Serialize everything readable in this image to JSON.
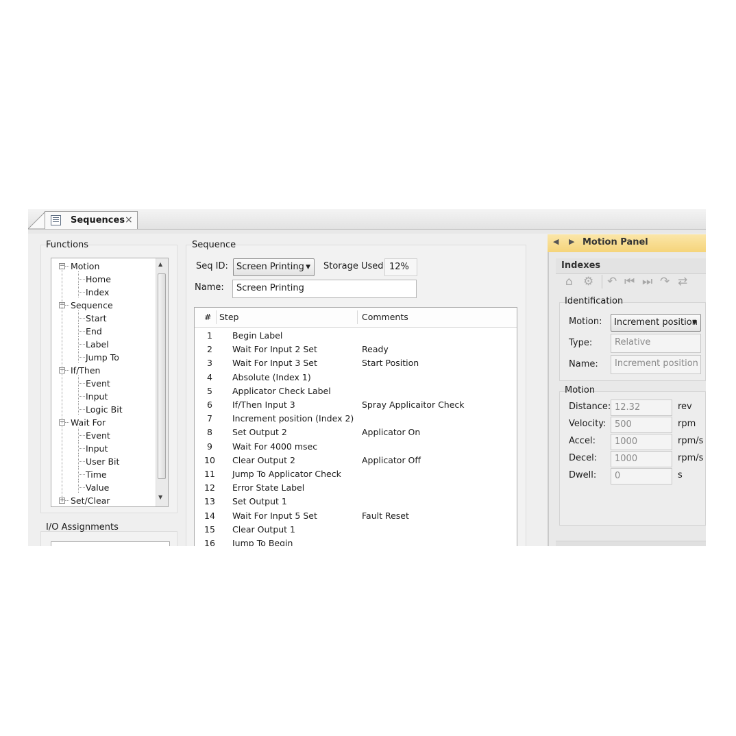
{
  "tab": {
    "title": "Sequences",
    "close": "×"
  },
  "functions": {
    "title": "Functions",
    "tree": [
      {
        "label": "Motion",
        "level": 0,
        "expander": "−"
      },
      {
        "label": "Home",
        "level": 1
      },
      {
        "label": "Index",
        "level": 1
      },
      {
        "label": "Sequence",
        "level": 0,
        "expander": "−"
      },
      {
        "label": "Start",
        "level": 1
      },
      {
        "label": "End",
        "level": 1
      },
      {
        "label": "Label",
        "level": 1
      },
      {
        "label": "Jump To",
        "level": 1
      },
      {
        "label": "If/Then",
        "level": 0,
        "expander": "−"
      },
      {
        "label": "Event",
        "level": 1
      },
      {
        "label": "Input",
        "level": 1
      },
      {
        "label": "Logic Bit",
        "level": 1
      },
      {
        "label": "Wait For",
        "level": 0,
        "expander": "−"
      },
      {
        "label": "Event",
        "level": 1
      },
      {
        "label": "Input",
        "level": 1
      },
      {
        "label": "User Bit",
        "level": 1
      },
      {
        "label": "Time",
        "level": 1
      },
      {
        "label": "Value",
        "level": 1
      },
      {
        "label": "Set/Clear",
        "level": 0,
        "expander": "+"
      }
    ]
  },
  "io": {
    "title": "I/O Assignments"
  },
  "sequence": {
    "title": "Sequence",
    "seq_id_label": "Seq ID:",
    "seq_id_value": "Screen Printing",
    "storage_label": "Storage Used:",
    "storage_value": "12%",
    "name_label": "Name:",
    "name_value": "Screen Printing",
    "columns": [
      "#",
      "Step",
      "Comments"
    ],
    "rows": [
      {
        "n": "1",
        "step": "Begin Label",
        "comment": ""
      },
      {
        "n": "2",
        "step": "Wait For Input 2 Set",
        "comment": "Ready"
      },
      {
        "n": "3",
        "step": "Wait For Input 3 Set",
        "comment": "Start Position"
      },
      {
        "n": "4",
        "step": "Absolute (Index 1)",
        "comment": ""
      },
      {
        "n": "5",
        "step": "Applicator Check Label",
        "comment": ""
      },
      {
        "n": "6",
        "step": "If/Then Input 3",
        "comment": "Spray Applicaitor Check"
      },
      {
        "n": "7",
        "step": "Increment position (Index 2)",
        "comment": ""
      },
      {
        "n": "8",
        "step": "Set Output 2",
        "comment": "Applicator On"
      },
      {
        "n": "9",
        "step": "Wait For 4000 msec",
        "comment": ""
      },
      {
        "n": "10",
        "step": "Clear Output 2",
        "comment": "Applicator Off"
      },
      {
        "n": "11",
        "step": "Jump To Applicator Check",
        "comment": ""
      },
      {
        "n": "12",
        "step": "Error State Label",
        "comment": ""
      },
      {
        "n": "13",
        "step": "Set Output 1",
        "comment": ""
      },
      {
        "n": "14",
        "step": "Wait For Input 5 Set",
        "comment": "Fault Reset"
      },
      {
        "n": "15",
        "step": "Clear Output 1",
        "comment": ""
      },
      {
        "n": "16",
        "step": "Jump To Begin",
        "comment": ""
      }
    ]
  },
  "motion_panel": {
    "title": "Motion Panel",
    "indexes_label": "Indexes",
    "toolbar_icons": [
      "home-icon",
      "home-gear-icon",
      "undo-icon",
      "skip-back-icon",
      "skip-forward-icon",
      "redo-icon",
      "swap-icon"
    ],
    "identification": {
      "title": "Identification",
      "motion_label": "Motion:",
      "motion_value": "Increment position",
      "type_label": "Type:",
      "type_value": "Relative",
      "name_label": "Name:",
      "name_value": "Increment position"
    },
    "motion": {
      "title": "Motion",
      "fields": [
        {
          "label": "Distance:",
          "value": "12.32",
          "unit": "rev"
        },
        {
          "label": "Velocity:",
          "value": "500",
          "unit": "rpm"
        },
        {
          "label": "Accel:",
          "value": "1000",
          "unit": "rpm/s"
        },
        {
          "label": "Decel:",
          "value": "1000",
          "unit": "rpm/s"
        },
        {
          "label": "Dwell:",
          "value": "0",
          "unit": "s"
        }
      ]
    }
  }
}
